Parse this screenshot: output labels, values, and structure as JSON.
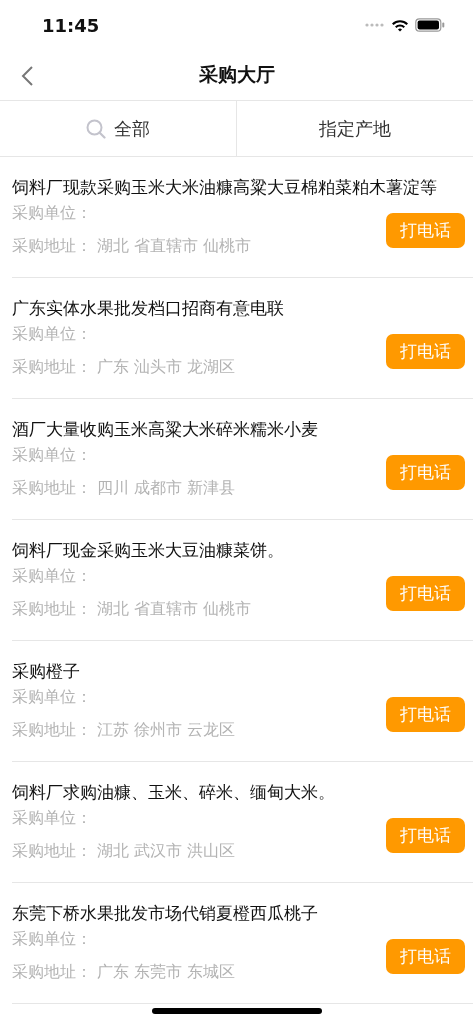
{
  "status_bar": {
    "time": "11:45"
  },
  "nav": {
    "title": "采购大厅"
  },
  "tabs": [
    {
      "label": "全部",
      "kind": "search"
    },
    {
      "label": "指定产地",
      "kind": "plain"
    }
  ],
  "rows": [
    {
      "title": "饲料厂现款采购玉米大米油糠高粱大豆棉粕菜粕木薯淀等",
      "unit": "采购单位：",
      "address": "采购地址： 湖北 省直辖市 仙桃市",
      "button": "打电话"
    },
    {
      "title": "广东实体水果批发档口招商有意电联",
      "unit": "采购单位：",
      "address": "采购地址： 广东 汕头市 龙湖区",
      "button": "打电话"
    },
    {
      "title": "酒厂大量收购玉米高粱大米碎米糯米小麦",
      "unit": "采购单位：",
      "address": "采购地址： 四川 成都市 新津县",
      "button": "打电话"
    },
    {
      "title": "饲料厂现金采购玉米大豆油糠菜饼。",
      "unit": "采购单位：",
      "address": "采购地址： 湖北 省直辖市 仙桃市",
      "button": "打电话"
    },
    {
      "title": "采购橙子",
      "unit": "采购单位：",
      "address": "采购地址： 江苏 徐州市 云龙区",
      "button": "打电话"
    },
    {
      "title": "饲料厂求购油糠、玉米、碎米、缅甸大米。",
      "unit": "采购单位：",
      "address": "采购地址： 湖北 武汉市 洪山区",
      "button": "打电话"
    },
    {
      "title": "东莞下桥水果批发市场代销夏橙西瓜桃子",
      "unit": "采购单位：",
      "address": "采购地址： 广东 东莞市 东城区",
      "button": "打电话"
    }
  ]
}
